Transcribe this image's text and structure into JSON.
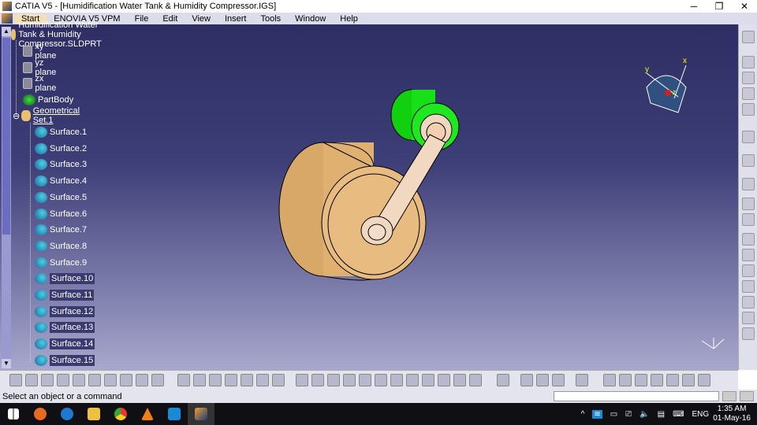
{
  "window": {
    "title": "CATIA V5 - [Humidification Water Tank & Humidity Compressor.IGS]",
    "minimize": "─",
    "restore": "❐",
    "close": "✕"
  },
  "menu": [
    "Start",
    "ENOVIA V5 VPM",
    "File",
    "Edit",
    "View",
    "Insert",
    "Tools",
    "Window",
    "Help"
  ],
  "tree": {
    "root": "Humidification Water Tank & Humidity Compressor.SLDPRT",
    "planes": [
      "xy plane",
      "yz plane",
      "zx plane"
    ],
    "body": "PartBody",
    "geoset": "Geometrical Set.1",
    "surfaces": [
      "Surface.1",
      "Surface.2",
      "Surface.3",
      "Surface.4",
      "Surface.5",
      "Surface.6",
      "Surface.7",
      "Surface.8",
      "Surface.9",
      "Surface.10",
      "Surface.11",
      "Surface.12",
      "Surface.13",
      "Surface.14",
      "Surface.15"
    ]
  },
  "compass": {
    "x": "x",
    "y": "y",
    "z": "z"
  },
  "status": {
    "message": "Select an object or a command"
  },
  "taskbar": {
    "lang": "ENG",
    "time": "1:35 AM",
    "date": "01-May-16"
  },
  "colors": {
    "cylinder": "#e8b878",
    "green": "#10e010",
    "bg_top": "#2e2e64",
    "bg_bottom": "#a8a8cc"
  }
}
